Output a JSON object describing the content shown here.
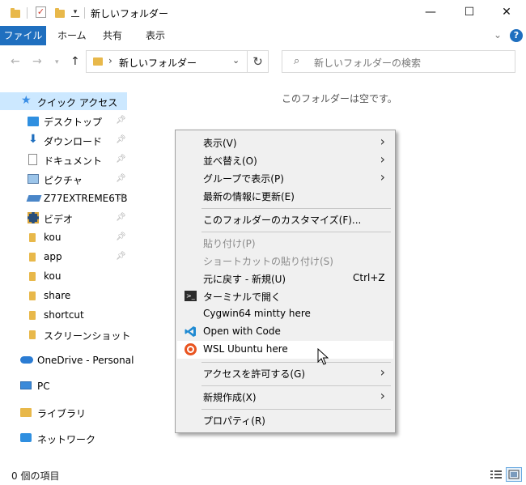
{
  "window": {
    "title": "新しいフォルダー",
    "controls": {
      "minimize": "—",
      "maximize": "☐",
      "close": "✕"
    }
  },
  "ribbon": {
    "tabs": [
      {
        "label": "ファイル"
      },
      {
        "label": "ホーム"
      },
      {
        "label": "共有"
      },
      {
        "label": "表示"
      }
    ],
    "help": "?"
  },
  "address": {
    "path": "新しいフォルダー",
    "search_placeholder": "新しいフォルダーの検索"
  },
  "sidebar": {
    "quick_access": "クイック アクセス",
    "items": [
      {
        "label": "デスクトップ",
        "icon": "desktop-icon",
        "pinned": true
      },
      {
        "label": "ダウンロード",
        "icon": "download-icon",
        "pinned": true
      },
      {
        "label": "ドキュメント",
        "icon": "document-icon",
        "pinned": true
      },
      {
        "label": "ピクチャ",
        "icon": "pictures-icon",
        "pinned": true
      },
      {
        "label": "Z77EXTREME6TB",
        "icon": "drive-icon",
        "pinned": true
      },
      {
        "label": "ビデオ",
        "icon": "video-icon",
        "pinned": true
      },
      {
        "label": "kou",
        "icon": "folder-icon",
        "pinned": true
      },
      {
        "label": "app",
        "icon": "folder-icon",
        "pinned": true
      },
      {
        "label": "kou",
        "icon": "folder-icon",
        "pinned": false
      },
      {
        "label": "share",
        "icon": "folder-icon",
        "pinned": false
      },
      {
        "label": "shortcut",
        "icon": "folder-icon",
        "pinned": false
      },
      {
        "label": "スクリーンショット",
        "icon": "folder-icon",
        "pinned": false
      }
    ],
    "onedrive": "OneDrive - Personal",
    "pc": "PC",
    "libraries": "ライブラリ",
    "network": "ネットワーク"
  },
  "content": {
    "empty_message": "このフォルダーは空です。"
  },
  "context_menu": {
    "items": [
      {
        "label": "表示(V)",
        "submenu": true
      },
      {
        "label": "並べ替え(O)",
        "submenu": true
      },
      {
        "label": "グループで表示(P)",
        "submenu": true
      },
      {
        "label": "最新の情報に更新(E)"
      },
      {
        "label": "このフォルダーのカスタマイズ(F)..."
      },
      {
        "label": "貼り付け(P)",
        "disabled": true
      },
      {
        "label": "ショートカットの貼り付け(S)",
        "disabled": true
      },
      {
        "label": "元に戻す - 新規(U)",
        "shortcut": "Ctrl+Z"
      },
      {
        "label": "ターミナルで開く",
        "icon": "terminal-icon"
      },
      {
        "label": "Cygwin64 mintty here"
      },
      {
        "label": "Open with Code",
        "icon": "vscode-icon"
      },
      {
        "label": "WSL Ubuntu here",
        "icon": "ubuntu-icon",
        "hovered": true
      },
      {
        "label": "アクセスを許可する(G)",
        "submenu": true
      },
      {
        "label": "新規作成(X)",
        "submenu": true
      },
      {
        "label": "プロパティ(R)"
      }
    ]
  },
  "status": {
    "item_count": "0 個の項目"
  },
  "colors": {
    "accent": "#1f6fbf",
    "selection": "#cce8ff",
    "folder": "#e8b84a"
  }
}
